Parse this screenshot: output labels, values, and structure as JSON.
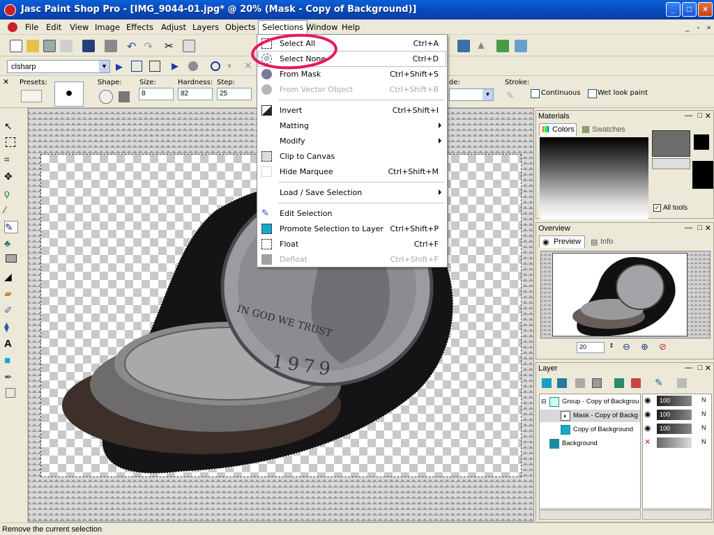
{
  "window": {
    "title": "Jasc Paint Shop Pro - [IMG_9044-01.jpg* @  20% (Mask - Copy of Background)]",
    "min": "_",
    "max": "□",
    "close": "×"
  },
  "menus": [
    "File",
    "Edit",
    "View",
    "Image",
    "Effects",
    "Adjust",
    "Layers",
    "Objects",
    "Selections",
    "Window",
    "Help"
  ],
  "script_bar": {
    "script_name": "clsharp"
  },
  "tool_options": {
    "presets_label": "Presets:",
    "shape_label": "Shape:",
    "size_label": "Size:",
    "size": "8",
    "hardness_label": "Hardness:",
    "hardness": "82",
    "step_label": "Step:",
    "step": "25",
    "mode_label": "de:",
    "stroke_label": "Stroke:",
    "continuous_label": "Continuous",
    "wet_look_label": "Wet look paint"
  },
  "selections_menu": [
    {
      "label": "Select All",
      "shortcut": "Ctrl+A",
      "disabled": false
    },
    {
      "label": "Select None",
      "shortcut": "Ctrl+D",
      "disabled": false
    },
    {
      "label": "From Mask",
      "shortcut": "Ctrl+Shift+S",
      "disabled": false
    },
    {
      "label": "From Vector Object",
      "shortcut": "Ctrl+Shift+B",
      "disabled": true
    },
    {
      "label": "Invert",
      "shortcut": "Ctrl+Shift+I",
      "disabled": false
    },
    {
      "label": "Matting",
      "shortcut": "",
      "disabled": false
    },
    {
      "label": "Modify",
      "shortcut": "",
      "disabled": false
    },
    {
      "label": "Clip to Canvas",
      "shortcut": "",
      "disabled": false
    },
    {
      "label": "Hide Marquee",
      "shortcut": "Ctrl+Shift+M",
      "disabled": false
    },
    {
      "label": "Load / Save Selection",
      "shortcut": "",
      "disabled": false
    },
    {
      "label": "Edit Selection",
      "shortcut": "",
      "disabled": false
    },
    {
      "label": "Promote Selection to Layer",
      "shortcut": "Ctrl+Shift+P",
      "disabled": false
    },
    {
      "label": "Float",
      "shortcut": "Ctrl+F",
      "disabled": false
    },
    {
      "label": "Defloat",
      "shortcut": "Ctrl+Shift+F",
      "disabled": true
    }
  ],
  "materials": {
    "title": "Materials",
    "tab_colors": "Colors",
    "tab_swatches": "Swatches",
    "all_tools": "All tools"
  },
  "overview": {
    "title": "Overview",
    "tab_preview": "Preview",
    "tab_info": "Info",
    "zoom": "20"
  },
  "layers": {
    "title": "Layer",
    "rows": [
      {
        "name": "Group - Copy of Backgrou",
        "opacity": "100",
        "mode": "N"
      },
      {
        "name": "Mask - Copy of Backg",
        "opacity": "100",
        "mode": "N"
      },
      {
        "name": "Copy of Background",
        "opacity": "100",
        "mode": "N"
      },
      {
        "name": "Background",
        "opacity": "",
        "mode": "N"
      }
    ]
  },
  "coin": {
    "year": "1979",
    "motto": "IN GOD WE TRUST"
  },
  "status": {
    "text": "Remove the current selection"
  },
  "colors": {
    "title_bar": "#0a55d0",
    "highlight_circle": "#e8175d",
    "menu_bg": "#ece9d8"
  }
}
